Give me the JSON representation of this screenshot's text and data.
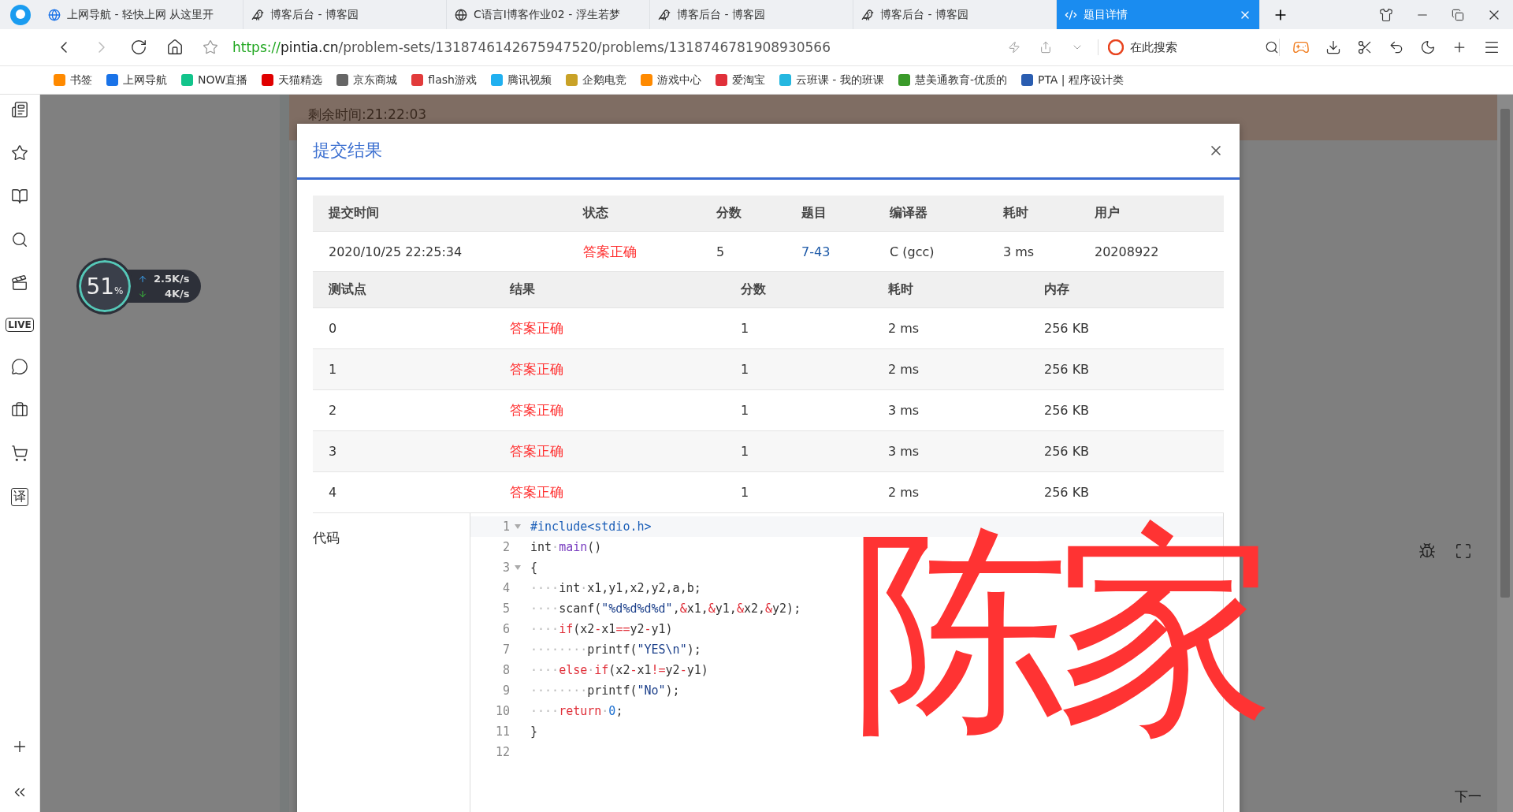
{
  "tabs": [
    {
      "title": "上网导航 - 轻快上网 从这里开",
      "selected": false
    },
    {
      "title": "博客后台 - 博客园",
      "selected": false
    },
    {
      "title": "C语言I博客作业02 - 浮生若梦",
      "selected": false
    },
    {
      "title": "博客后台 - 博客园",
      "selected": false
    },
    {
      "title": "博客后台 - 博客园",
      "selected": false
    },
    {
      "title": "题目详情",
      "selected": true
    }
  ],
  "address_bar": {
    "scheme": "https://",
    "host": "pintia.cn",
    "path": "/problem-sets/1318746142675947520/problems/1318746781908930566"
  },
  "search": {
    "placeholder": "在此搜索"
  },
  "bookmarks": [
    {
      "label": "书签",
      "color": "#ff8a00"
    },
    {
      "label": "上网导航",
      "color": "#1a73e8"
    },
    {
      "label": "NOW直播",
      "color": "#12c48b"
    },
    {
      "label": "天猫精选",
      "color": "#e00000"
    },
    {
      "label": "京东商城",
      "color": "#666666"
    },
    {
      "label": "flash游戏",
      "color": "#e23b3b"
    },
    {
      "label": "腾讯视频",
      "color": "#20b0f0"
    },
    {
      "label": "企鹅电竞",
      "color": "#c9a227"
    },
    {
      "label": "游戏中心",
      "color": "#ff8a00"
    },
    {
      "label": "爱淘宝",
      "color": "#e0303a"
    },
    {
      "label": "云班课 - 我的班课",
      "color": "#25b7e0"
    },
    {
      "label": "慧美通教育-优质的",
      "color": "#3a9a2a"
    },
    {
      "label": "PTA | 程序设计类",
      "color": "#2a5db0"
    }
  ],
  "sidebar": {
    "translate_label": "译",
    "live_label": "LIVE"
  },
  "net_monitor": {
    "percent": "51",
    "percent_sign": "%",
    "upload": "2.5",
    "upload_unit": "K/s",
    "download": "4",
    "download_unit": "K/s"
  },
  "page": {
    "timer": "剩余时间:21:22:03",
    "next_label": "下一"
  },
  "dialog": {
    "title": "提交结果",
    "summary": {
      "columns": [
        "提交时间",
        "状态",
        "分数",
        "题目",
        "编译器",
        "耗时",
        "用户"
      ],
      "row": [
        {
          "text": "2020/10/25 22:25:34",
          "kind": "plain"
        },
        {
          "text": "答案正确",
          "kind": "status"
        },
        {
          "text": "5",
          "kind": "plain"
        },
        {
          "text": "7-43",
          "kind": "link"
        },
        {
          "text": "C (gcc)",
          "kind": "plain"
        },
        {
          "text": "3 ms",
          "kind": "plain"
        },
        {
          "text": "20208922",
          "kind": "plain"
        }
      ]
    },
    "tests": {
      "columns": [
        "测试点",
        "结果",
        "分数",
        "耗时",
        "内存"
      ],
      "rows": [
        [
          "0",
          "答案正确",
          "1",
          "2 ms",
          "256 KB"
        ],
        [
          "1",
          "答案正确",
          "1",
          "2 ms",
          "256 KB"
        ],
        [
          "2",
          "答案正确",
          "1",
          "3 ms",
          "256 KB"
        ],
        [
          "3",
          "答案正确",
          "1",
          "3 ms",
          "256 KB"
        ],
        [
          "4",
          "答案正确",
          "1",
          "2 ms",
          "256 KB"
        ]
      ]
    },
    "code_label": "代码",
    "code": [
      {
        "number": "1",
        "foldable": true,
        "tokens": [
          {
            "kind": "pp",
            "text": "#include<stdio.h>"
          }
        ]
      },
      {
        "number": "2",
        "foldable": false,
        "tokens": [
          {
            "kind": "plain",
            "text": "int"
          },
          {
            "kind": "ws",
            "text": "·"
          },
          {
            "kind": "fn",
            "text": "main"
          },
          {
            "kind": "plain",
            "text": "()"
          }
        ]
      },
      {
        "number": "3",
        "foldable": true,
        "tokens": [
          {
            "kind": "plain",
            "text": "{"
          }
        ]
      },
      {
        "number": "4",
        "foldable": false,
        "tokens": [
          {
            "kind": "ws",
            "text": "····"
          },
          {
            "kind": "plain",
            "text": "int"
          },
          {
            "kind": "ws",
            "text": "·"
          },
          {
            "kind": "plain",
            "text": "x1,y1,x2,y2,a,b;"
          }
        ]
      },
      {
        "number": "5",
        "foldable": false,
        "tokens": [
          {
            "kind": "ws",
            "text": "····"
          },
          {
            "kind": "plain",
            "text": "scanf("
          },
          {
            "kind": "str",
            "text": "\"%d%d%d%d\""
          },
          {
            "kind": "plain",
            "text": ","
          },
          {
            "kind": "op",
            "text": "&"
          },
          {
            "kind": "plain",
            "text": "x1,"
          },
          {
            "kind": "op",
            "text": "&"
          },
          {
            "kind": "plain",
            "text": "y1,"
          },
          {
            "kind": "op",
            "text": "&"
          },
          {
            "kind": "plain",
            "text": "x2,"
          },
          {
            "kind": "op",
            "text": "&"
          },
          {
            "kind": "plain",
            "text": "y2);"
          }
        ]
      },
      {
        "number": "6",
        "foldable": false,
        "tokens": [
          {
            "kind": "ws",
            "text": "····"
          },
          {
            "kind": "kw",
            "text": "if"
          },
          {
            "kind": "plain",
            "text": "(x2"
          },
          {
            "kind": "op",
            "text": "-"
          },
          {
            "kind": "plain",
            "text": "x1"
          },
          {
            "kind": "op",
            "text": "=="
          },
          {
            "kind": "plain",
            "text": "y2"
          },
          {
            "kind": "op",
            "text": "-"
          },
          {
            "kind": "plain",
            "text": "y1)"
          }
        ]
      },
      {
        "number": "7",
        "foldable": false,
        "tokens": [
          {
            "kind": "ws",
            "text": "········"
          },
          {
            "kind": "plain",
            "text": "printf("
          },
          {
            "kind": "str",
            "text": "\"YES\\n\""
          },
          {
            "kind": "plain",
            "text": ");"
          }
        ]
      },
      {
        "number": "8",
        "foldable": false,
        "tokens": [
          {
            "kind": "ws",
            "text": "····"
          },
          {
            "kind": "kw",
            "text": "else"
          },
          {
            "kind": "ws",
            "text": "·"
          },
          {
            "kind": "kw",
            "text": "if"
          },
          {
            "kind": "plain",
            "text": "(x2"
          },
          {
            "kind": "op",
            "text": "-"
          },
          {
            "kind": "plain",
            "text": "x1"
          },
          {
            "kind": "op",
            "text": "!="
          },
          {
            "kind": "plain",
            "text": "y2"
          },
          {
            "kind": "op",
            "text": "-"
          },
          {
            "kind": "plain",
            "text": "y1)"
          }
        ]
      },
      {
        "number": "9",
        "foldable": false,
        "tokens": [
          {
            "kind": "ws",
            "text": "········"
          },
          {
            "kind": "plain",
            "text": "printf("
          },
          {
            "kind": "str",
            "text": "\"No\""
          },
          {
            "kind": "plain",
            "text": ");"
          }
        ]
      },
      {
        "number": "10",
        "foldable": false,
        "tokens": [
          {
            "kind": "ws",
            "text": "····"
          },
          {
            "kind": "kw",
            "text": "return"
          },
          {
            "kind": "ws",
            "text": "·"
          },
          {
            "kind": "num",
            "text": "0"
          },
          {
            "kind": "plain",
            "text": ";"
          }
        ]
      },
      {
        "number": "11",
        "foldable": false,
        "tokens": [
          {
            "kind": "plain",
            "text": "}"
          }
        ]
      },
      {
        "number": "12",
        "foldable": false
      }
    ]
  },
  "annotation": {
    "text": "陈家"
  }
}
